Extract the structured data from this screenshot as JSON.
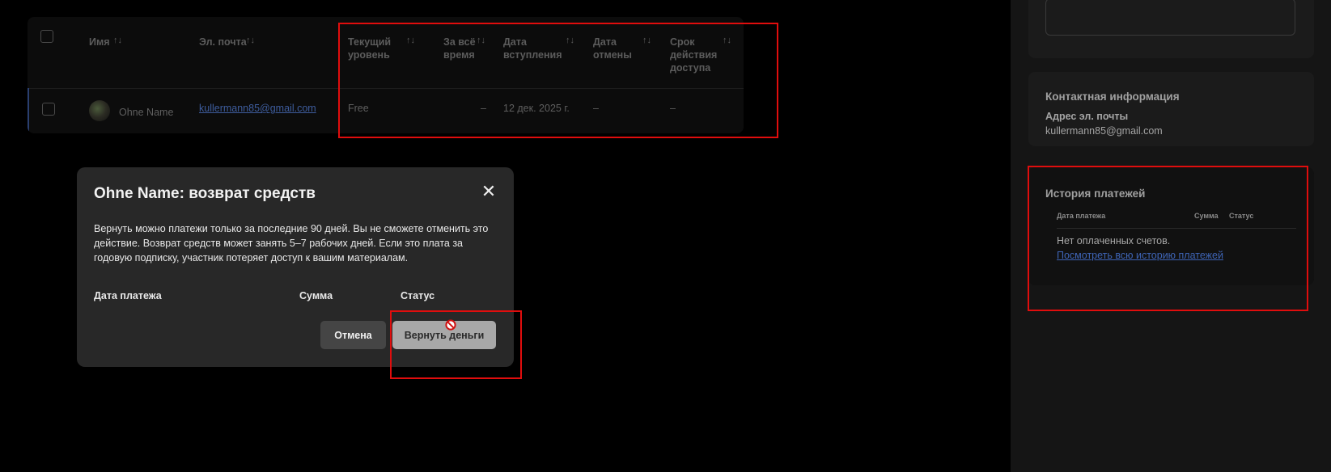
{
  "table": {
    "headers": {
      "name": "Имя",
      "email": "Эл. почта",
      "tier_line1": "Текущий",
      "tier_line2": "уровень",
      "alltime_line1": "За всё",
      "alltime_line2": "время",
      "joined_line1": "Дата",
      "joined_line2": "вступления",
      "canceled_line1": "Дата",
      "canceled_line2": "отмены",
      "access_line1": "Срок",
      "access_line2": "действия",
      "access_line3": "доступа",
      "sort_icon": "↑↓"
    },
    "row": {
      "name": "Ohne Name",
      "email": "kullermann85@gmail.com",
      "tier": "Free",
      "alltime": "–",
      "joined": "12 дек. 2025 г.",
      "canceled": "–",
      "access": "–"
    }
  },
  "dialog": {
    "title": "Ohne Name: возврат средств",
    "close_icon": "✕",
    "body": "Вернуть можно платежи только за последние 90 дней. Вы не сможете отменить это действие. Возврат средств может занять 5–7 рабочих дней. Если это плата за годовую подписку, участник потеряет доступ к вашим материалам.",
    "col_date": "Дата платежа",
    "col_amount": "Сумма",
    "col_status": "Статус",
    "cancel_label": "Отмена",
    "refund_label": "Вернуть деньги"
  },
  "sidebar": {
    "contact": {
      "title": "Контактная информация",
      "email_label": "Адрес эл. почты",
      "email_value": "kullermann85@gmail.com"
    },
    "history": {
      "title": "История платежей",
      "col_date": "Дата платежа",
      "col_amount": "Сумма",
      "col_status": "Статус",
      "empty": "Нет оплаченных счетов.",
      "link": "Посмотреть всю историю платежей"
    }
  },
  "colors": {
    "highlight": "#e00d0d",
    "link": "#3e64b5",
    "dialog_bg": "#282828"
  }
}
